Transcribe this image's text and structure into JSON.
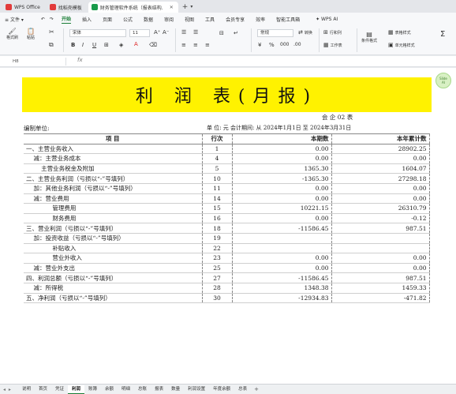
{
  "tabs": [
    {
      "label": "WPS Office",
      "icon": "wps-logo-icon",
      "color": "#e23b3b"
    },
    {
      "label": "找稻壳模板",
      "icon": "docer-logo-icon",
      "color": "#e23b3b"
    },
    {
      "label": "财务管理软件系统（报表结构...",
      "icon": "spreadsheet-icon",
      "color": "#1a9b4b"
    }
  ],
  "menu": {
    "file": "文件",
    "items": [
      "开始",
      "插入",
      "页面",
      "公式",
      "数据",
      "审阅",
      "视图",
      "工具",
      "会员专享",
      "效率",
      "智能工具箱"
    ],
    "active": "开始",
    "wps_ai": "WPS AI"
  },
  "ribbon": {
    "format_painter": "格式刷",
    "paste": "粘贴",
    "font_name": "宋体",
    "font_size": "11",
    "number_format": "常规",
    "convert": "转换",
    "row_col": "行和列",
    "worksheet": "工作表",
    "conditional_format": "条件格式",
    "table_style": "表格样式",
    "cell_style": "单元格样式",
    "cell_label": "单元格",
    "fill": "填充",
    "sort": "排序",
    "filter": "筛选",
    "accent": "#1a7d36"
  },
  "formula_bar": {
    "cell_ref": "H8",
    "fx": "fx"
  },
  "sheet": {
    "title": "利 润 表(月报)",
    "form_no": "会 企 02 表",
    "org_label": "编制单位:",
    "unit_text": "单 位: 元   会计期间: 从    2024年1月1日    至    2024年3月31日",
    "banner_color": "#fff200",
    "ai_badge": "Slide\nAI"
  },
  "report": {
    "headers": [
      "项        目",
      "行次",
      "本期数",
      "本年累计数"
    ],
    "rows": [
      {
        "item": "一、主营业务收入",
        "line": "1",
        "current": "0.00",
        "ytd": "28902.25"
      },
      {
        "item": "    减：主营业务成本",
        "line": "4",
        "current": "0.00",
        "ytd": "0.00"
      },
      {
        "item": "        主营业务税金及附加",
        "line": "5",
        "current": "1365.30",
        "ytd": "1604.07"
      },
      {
        "item": "二、主营业务利润（亏损以“-”号填列）",
        "line": "10",
        "current": "-1365.30",
        "ytd": "27298.18"
      },
      {
        "item": "    加：其他业务利润（亏损以“-”号填列）",
        "line": "11",
        "current": "0.00",
        "ytd": "0.00"
      },
      {
        "item": "    减：营业费用",
        "line": "14",
        "current": "0.00",
        "ytd": "0.00"
      },
      {
        "item": "              管理费用",
        "line": "15",
        "current": "10221.15",
        "ytd": "26310.79"
      },
      {
        "item": "              财务费用",
        "line": "16",
        "current": "0.00",
        "ytd": "-0.12"
      },
      {
        "item": "三、营业利润（亏损以“-”号填列）",
        "line": "18",
        "current": "-11586.45",
        "ytd": "987.51"
      },
      {
        "item": "    加：投资收益（亏损以“-”号填列）",
        "line": "19",
        "current": "",
        "ytd": ""
      },
      {
        "item": "              补贴收入",
        "line": "22",
        "current": "",
        "ytd": ""
      },
      {
        "item": "              营业外收入",
        "line": "23",
        "current": "0.00",
        "ytd": "0.00"
      },
      {
        "item": "    减：营业外支出",
        "line": "25",
        "current": "0.00",
        "ytd": "0.00"
      },
      {
        "item": "四、利润总额（亏损以“-”号填列）",
        "line": "27",
        "current": "-11586.45",
        "ytd": "987.51"
      },
      {
        "item": "    减：所得税",
        "line": "28",
        "current": "1348.38",
        "ytd": "1459.33"
      },
      {
        "item": "五、净利润（亏损以“-”号填列）",
        "line": "30",
        "current": "-12934.83",
        "ytd": "-471.82"
      }
    ]
  },
  "sheet_tabs": {
    "items": [
      "说明",
      "首页",
      "凭证",
      "利润",
      "账簿",
      "余额",
      "明细",
      "总账",
      "报表",
      "数量",
      "利润设置",
      "年度余额",
      "总表"
    ],
    "active": "利润"
  }
}
